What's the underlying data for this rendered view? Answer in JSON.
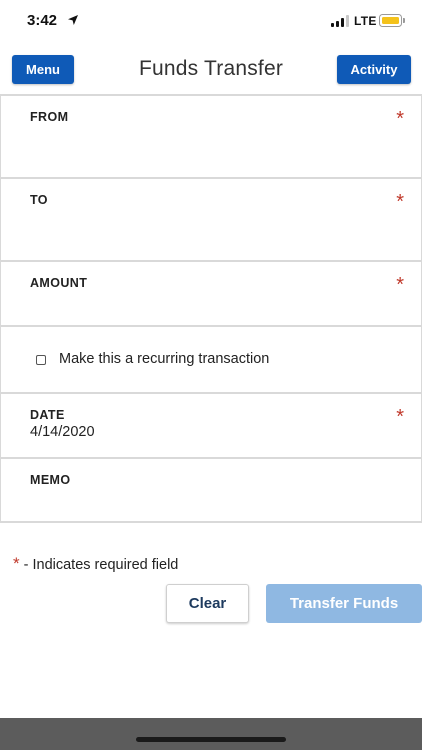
{
  "status_bar": {
    "time": "3:42",
    "network": "LTE",
    "battery_color": "#f4c21b"
  },
  "header": {
    "menu_label": "Menu",
    "title": "Funds Transfer",
    "activity_label": "Activity",
    "accent_color": "#0f5ab7"
  },
  "form": {
    "from": {
      "label": "FROM",
      "value": "",
      "required_mark": "*"
    },
    "to": {
      "label": "TO",
      "value": "",
      "required_mark": "*"
    },
    "amount": {
      "label": "AMOUNT",
      "value": "",
      "required_mark": "*"
    },
    "recurring": {
      "label": "Make this a recurring transaction",
      "checked": false
    },
    "date": {
      "label": "DATE",
      "value": "4/14/2020",
      "required_mark": "*"
    },
    "memo": {
      "label": "MEMO",
      "value": ""
    }
  },
  "required_note": {
    "star": "*",
    "text": "- Indicates required field"
  },
  "actions": {
    "clear_label": "Clear",
    "transfer_label": "Transfer Funds"
  }
}
